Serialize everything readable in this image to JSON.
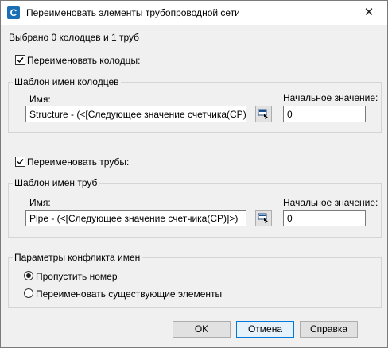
{
  "window": {
    "title": "Переименовать элементы трубопроводной сети",
    "close_glyph": "✕"
  },
  "summary": "Выбрано 0 колодцев и 1 труб",
  "structures": {
    "checkbox_label": "Переименовать колодцы:",
    "checked": true,
    "group_label": "Шаблон имен колодцев",
    "name_label": "Имя:",
    "name_value": "Structure - (<[Следующее значение счетчика(CP)]>)",
    "start_label": "Начальное значение:",
    "start_value": "0"
  },
  "pipes": {
    "checkbox_label": "Переименовать трубы:",
    "checked": true,
    "group_label": "Шаблон имен труб",
    "name_label": "Имя:",
    "name_value": "Pipe - (<[Следующее значение счетчика(CP)]>)",
    "start_label": "Начальное значение:",
    "start_value": "0"
  },
  "conflict": {
    "group_label": "Параметры конфликта имен",
    "options": [
      {
        "label": "Пропустить номер",
        "selected": true
      },
      {
        "label": "Переименовать существующие элементы",
        "selected": false
      }
    ]
  },
  "buttons": {
    "ok": "OK",
    "cancel": "Отмена",
    "help": "Справка"
  },
  "icons": {
    "app": "civil3d-app-icon",
    "pick": "pick-from-drawing-icon",
    "close": "close-icon"
  },
  "colors": {
    "accent": "#0078d7",
    "app_icon": "#1b6fb5"
  }
}
